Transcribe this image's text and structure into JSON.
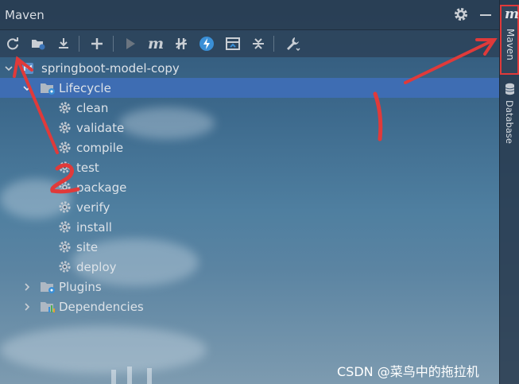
{
  "panel": {
    "title": "Maven"
  },
  "toolbar": {
    "icons": [
      "reload-icon",
      "open-folder-icon",
      "download-icon",
      "add-icon",
      "run-icon",
      "maven-goal-icon",
      "skip-tests-icon",
      "offline-icon",
      "show-dependencies-icon",
      "collapse-all-icon",
      "settings-wrench-icon"
    ]
  },
  "tree": {
    "project": "springboot-model-copy",
    "lifecycle": "Lifecycle",
    "goals": [
      "clean",
      "validate",
      "compile",
      "test",
      "package",
      "verify",
      "install",
      "site",
      "deploy"
    ],
    "plugins": "Plugins",
    "dependencies": "Dependencies"
  },
  "sidebar": {
    "maven_tab": "Maven",
    "database_tab": "Database",
    "maven_logo": "m"
  },
  "annotations": {
    "one": "1",
    "two": "2"
  },
  "watermark": "CSDN @菜鸟中的拖拉机",
  "colors": {
    "selection": "#3e6db3",
    "annotation": "#e03a3a"
  }
}
